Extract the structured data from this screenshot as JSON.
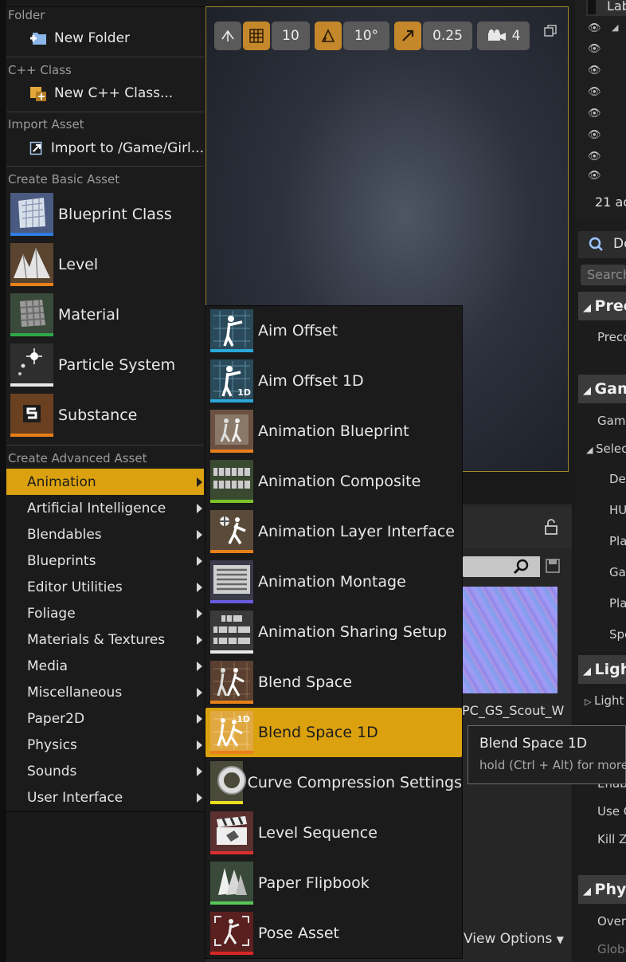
{
  "viewport_toolbar": {
    "grid_snap_value": "10",
    "rotation_snap_value": "10°",
    "scale_snap_value": "0.25",
    "camera_speed_value": "4"
  },
  "world_outliner": {
    "header_label": "Lab",
    "actors_count": "21 ac"
  },
  "details_panel": {
    "tab_label": "De",
    "search_placeholder": "Search",
    "categories": [
      "Prec",
      "Gam",
      "Ligh",
      "Phys"
    ],
    "properties": [
      "Preco",
      "Game",
      "Selec",
      "Def",
      "HU",
      "Pla",
      "Ga",
      "Pla",
      "Spe",
      "Light",
      "Enab",
      "Use C",
      "Kill Z",
      "Overr",
      "Globa"
    ]
  },
  "content_browser": {
    "asset_label": "PC_GS_Scout_W",
    "view_options": "View Options"
  },
  "menu": {
    "folder": {
      "header": "Folder",
      "item": "New Folder"
    },
    "cpp": {
      "header": "C++ Class",
      "item": "New C++ Class..."
    },
    "import": {
      "header": "Import Asset",
      "item": "Import to /Game/Girl..."
    },
    "basic": {
      "header": "Create Basic Asset",
      "items": [
        "Blueprint Class",
        "Level",
        "Material",
        "Particle System",
        "Substance"
      ]
    },
    "advanced": {
      "header": "Create Advanced Asset",
      "items": [
        "Animation",
        "Artificial Intelligence",
        "Blendables",
        "Blueprints",
        "Editor Utilities",
        "Foliage",
        "Materials & Textures",
        "Media",
        "Miscellaneous",
        "Paper2D",
        "Physics",
        "Sounds",
        "User Interface"
      ],
      "active": "Animation"
    }
  },
  "submenu": {
    "items": [
      "Aim Offset",
      "Aim Offset 1D",
      "Animation Blueprint",
      "Animation Composite",
      "Animation Layer Interface",
      "Animation Montage",
      "Animation Sharing Setup",
      "Blend Space",
      "Blend Space 1D",
      "Curve Compression Settings",
      "Level Sequence",
      "Paper Flipbook",
      "Pose Asset"
    ],
    "active": "Blend Space 1D",
    "badge_1d": "1D"
  },
  "tooltip": {
    "title": "Blend Space 1D",
    "hint": "hold (Ctrl + Alt) for more"
  },
  "colors": {
    "highlight": "#dba10e",
    "blueprint_bar": "#2e7de0",
    "level_bar": "#e8801a",
    "material_bar": "#2ea84a",
    "particle_bar": "#e8e8e8",
    "substance_bar": "#e8801a",
    "anim_bar": "#2aa8d8",
    "anim_bp_bar": "#e8801a",
    "composite_bar": "#7bc428",
    "montage_bar": "#6a5ae0",
    "curve_bar": "#e8e020",
    "sequence_bar": "#d83030",
    "flipbook_bar": "#58c858",
    "pose_bar": "#d82828"
  }
}
